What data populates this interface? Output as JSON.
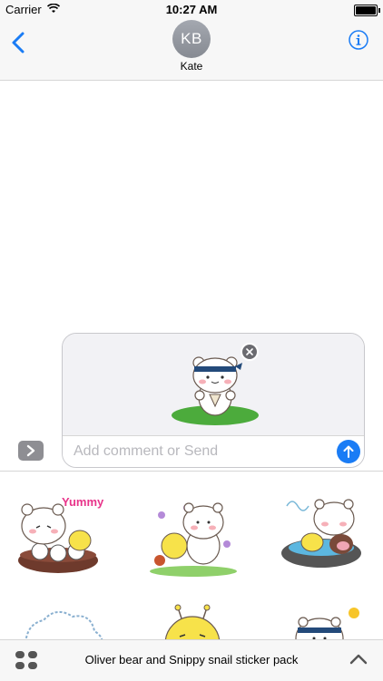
{
  "status_bar": {
    "carrier": "Carrier",
    "time": "10:27 AM"
  },
  "header": {
    "contact_initials": "KB",
    "contact_name": "Kate"
  },
  "composer": {
    "placeholder": "Add comment or Send"
  },
  "drawer": {
    "stickers": [
      {
        "label": "Yummy"
      },
      {
        "label": ""
      },
      {
        "label": ""
      },
      {
        "label": ""
      },
      {
        "label": ""
      },
      {
        "label": ""
      }
    ]
  },
  "bottom_bar": {
    "pack_title": "Oliver bear and Snippy snail sticker pack"
  },
  "colors": {
    "accent": "#1a7cf5",
    "avatar": "#9a9ea6",
    "chrome": "#f7f7f7"
  }
}
